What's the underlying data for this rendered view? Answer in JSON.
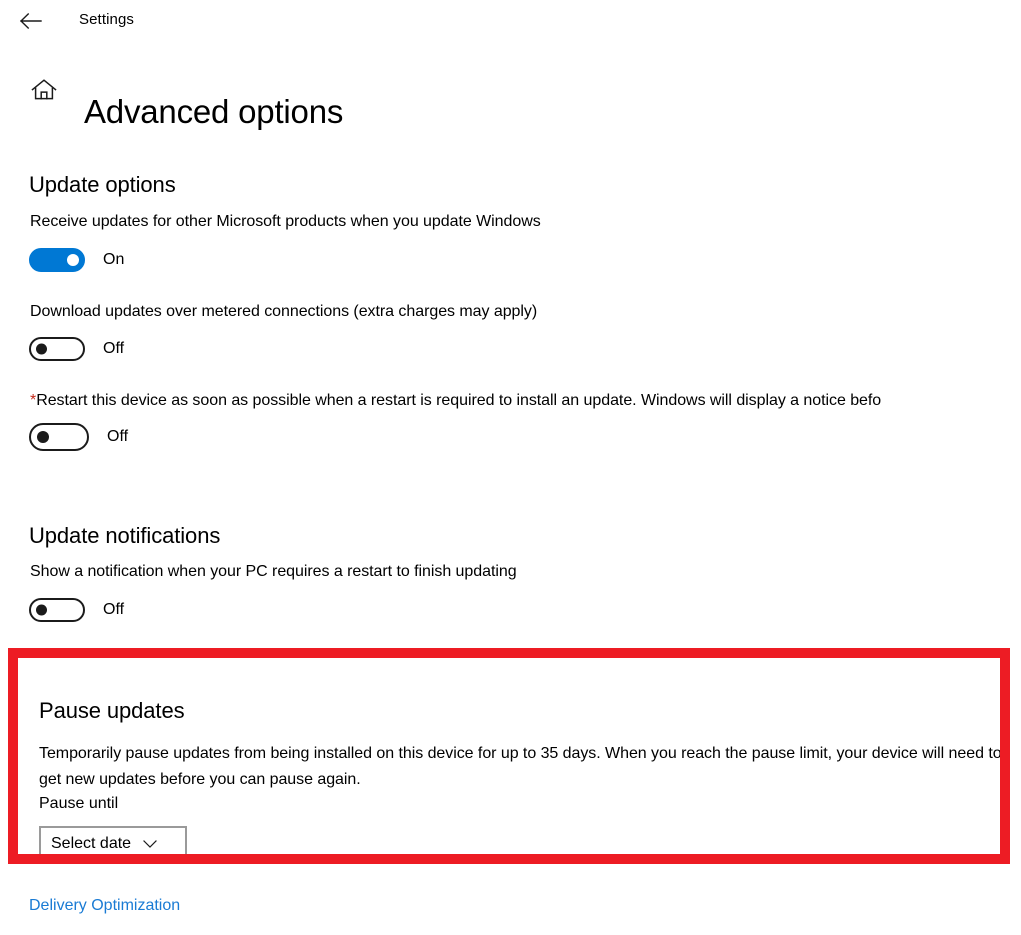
{
  "window": {
    "back_icon": "back-arrow-icon",
    "breadcrumb": "Settings"
  },
  "header": {
    "home_icon": "home-icon",
    "title": "Advanced options"
  },
  "sections": {
    "update_options": {
      "heading": "Update options",
      "settings": [
        {
          "label": "Receive updates for other Microsoft products when you update Windows",
          "state": "On",
          "checked": true
        },
        {
          "label": "Download updates over metered connections (extra charges may apply)",
          "state": "Off",
          "checked": false
        },
        {
          "asterisk": "*",
          "label": "Restart this device as soon as possible when a restart is required to install an update. Windows will display a notice befo",
          "state": "Off",
          "checked": false
        }
      ]
    },
    "update_notifications": {
      "heading": "Update notifications",
      "settings": [
        {
          "label": "Show a notification when your PC requires a restart to finish updating",
          "state": "Off",
          "checked": false
        }
      ]
    },
    "pause_updates": {
      "heading": "Pause updates",
      "description": "Temporarily pause updates from being installed on this device for up to 35 days. When you reach the pause limit, your device will need to get new updates before you can pause again.",
      "pause_until_label": "Pause until",
      "date_dropdown": {
        "value": "Select date",
        "chevron_icon": "chevron-down-icon"
      },
      "highlight_color": "#ED1C24"
    }
  },
  "footer": {
    "delivery_optimization_link": "Delivery Optimization"
  },
  "colors": {
    "accent_blue": "#0078D4",
    "link_blue": "#1A7BD4",
    "highlight_red": "#ED1C24",
    "asterisk_red": "#C42B1C",
    "toggle_off_border": "#1B1B1B",
    "dropdown_border": "#9A9A9A"
  }
}
